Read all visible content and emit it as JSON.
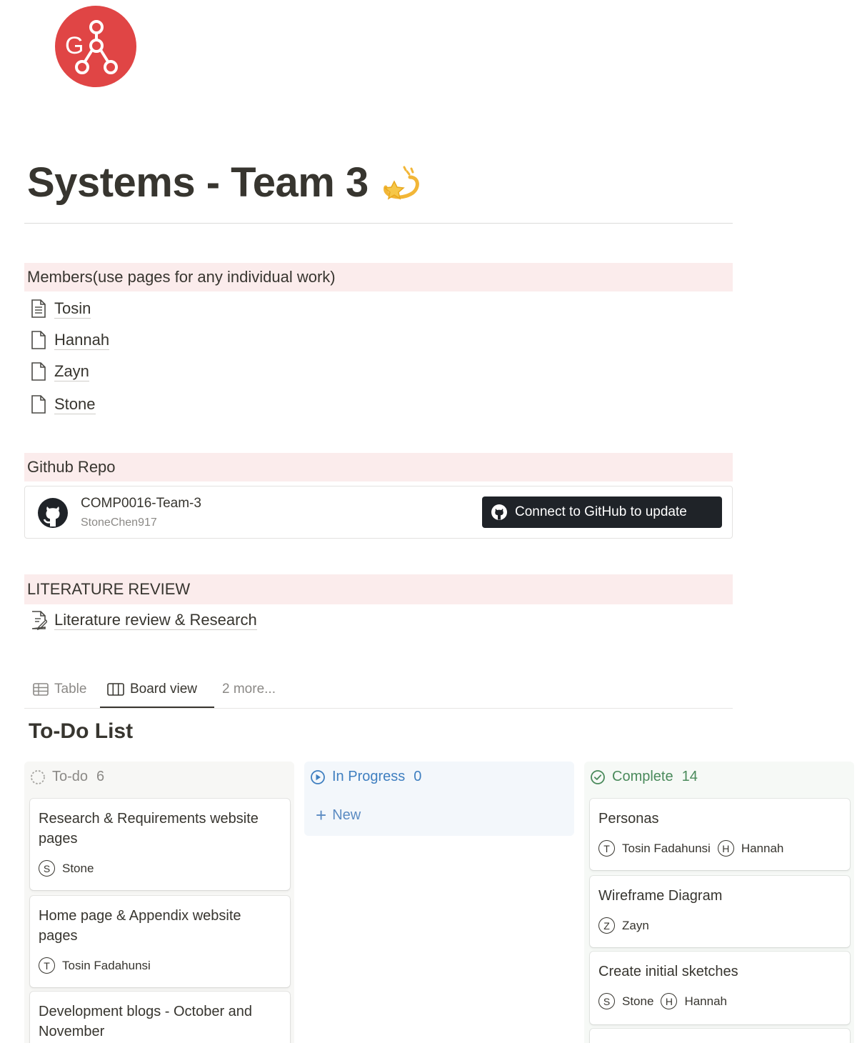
{
  "page": {
    "title": "Systems - Team 3",
    "title_emoji": "dizzy-star"
  },
  "members_section": {
    "heading": "Members(use pages for any individual work)",
    "pages": [
      {
        "label": "Tosin",
        "icon": "document-text-icon"
      },
      {
        "label": "Hannah",
        "icon": "document-icon"
      },
      {
        "label": "Zayn",
        "icon": "document-icon"
      },
      {
        "label": "Stone",
        "icon": "document-icon"
      }
    ]
  },
  "github_section": {
    "heading": "Github Repo",
    "repo_name": "COMP0016-Team-3",
    "owner": "StoneChen917",
    "connect_label": "Connect to GitHub to update"
  },
  "literature_section": {
    "heading": "LITERATURE REVIEW",
    "page_label": "Literature review & Research"
  },
  "views": {
    "tabs": [
      {
        "label": "Table",
        "icon": "table-icon"
      },
      {
        "label": "Board view",
        "icon": "board-icon",
        "active": true
      },
      {
        "label": "2 more..."
      }
    ]
  },
  "database": {
    "title": "To-Do List",
    "columns": [
      {
        "name": "To-do",
        "count": "6",
        "color": "#8b8986",
        "bg": "#f7f7f5",
        "cards": [
          {
            "title": "Research & Requirements website pages",
            "people": [
              {
                "initial": "S",
                "name": "Stone"
              }
            ]
          },
          {
            "title": "Home page & Appendix website pages",
            "people": [
              {
                "initial": "T",
                "name": "Tosin Fadahunsi"
              }
            ]
          },
          {
            "title": "Development blogs -  October and November",
            "people": []
          }
        ]
      },
      {
        "name": "In Progress",
        "count": "0",
        "color": "#3f7fc0",
        "bg": "#f3f7fb",
        "new_label": "New",
        "cards": []
      },
      {
        "name": "Complete",
        "count": "14",
        "color": "#4a8a5b",
        "bg": "#f6f9f6",
        "cards": [
          {
            "title": "Personas",
            "people": [
              {
                "initial": "T",
                "name": "Tosin Fadahunsi"
              },
              {
                "initial": "H",
                "name": "Hannah"
              }
            ]
          },
          {
            "title": "Wireframe Diagram",
            "people": [
              {
                "initial": "Z",
                "name": "Zayn"
              }
            ]
          },
          {
            "title": "Create initial sketches",
            "people": [
              {
                "initial": "S",
                "name": "Stone"
              },
              {
                "initial": "H",
                "name": "Hannah"
              }
            ]
          }
        ]
      }
    ]
  }
}
